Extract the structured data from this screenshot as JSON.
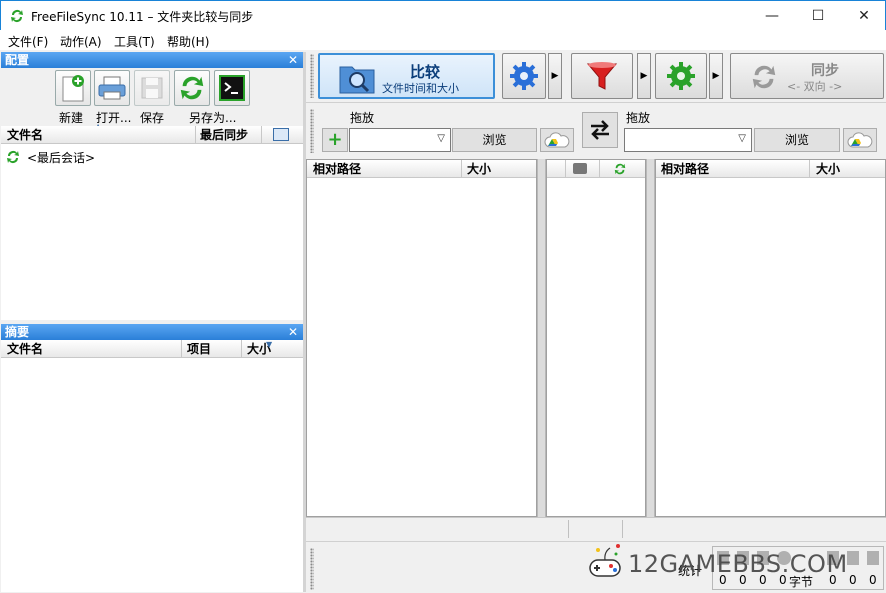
{
  "window": {
    "title": "FreeFileSync 10.11 – 文件夹比较与同步",
    "minimize_glyph": "—",
    "maximize_glyph": "☐",
    "close_glyph": "✕"
  },
  "menu": [
    "文件(F)",
    "动作(A)",
    "工具(T)",
    "帮助(H)"
  ],
  "config_panel": {
    "title": "配置",
    "close_glyph": "✕",
    "buttons": [
      {
        "label": "新建",
        "icon": "new-file-icon"
      },
      {
        "label": "打开...",
        "icon": "printer-open-icon"
      },
      {
        "label": "保存",
        "icon": "save-disk-icon"
      },
      {
        "label": "另存为...",
        "icon": "sync-arrows-icon"
      },
      {
        "label": "",
        "icon": "terminal-icon"
      }
    ],
    "columns": [
      "文件名",
      "最后同步"
    ],
    "items": [
      {
        "label": "<最后会话>",
        "icon": "sync-arrows-icon"
      }
    ]
  },
  "summary_panel": {
    "title": "摘要",
    "close_glyph": "✕",
    "columns": [
      "文件名",
      "项目",
      "大小"
    ]
  },
  "toolbar": {
    "compare_title": "比较",
    "compare_sub": "文件时间和大小",
    "sync_title": "同步",
    "sync_sub": "<- 双向 ->"
  },
  "folders": {
    "left_label": "拖放",
    "right_label": "拖放",
    "left_path": "",
    "right_path": "",
    "browse_label": "浏览"
  },
  "grid": {
    "left_columns": [
      "相对路径",
      "大小"
    ],
    "right_columns": [
      "相对路径",
      "大小"
    ]
  },
  "status": {
    "stats_label": "统计",
    "counts": [
      "0",
      "0",
      "0",
      "0",
      "0",
      "0",
      "0"
    ],
    "bytes_label": "字节"
  },
  "watermark": "12GAMEBBS.COM",
  "colors": {
    "accent": "#1883d7",
    "header_blue": "#2a7fd8",
    "green": "#2aa22a",
    "red": "#d82020",
    "blue_gear": "#2a6fd8"
  }
}
